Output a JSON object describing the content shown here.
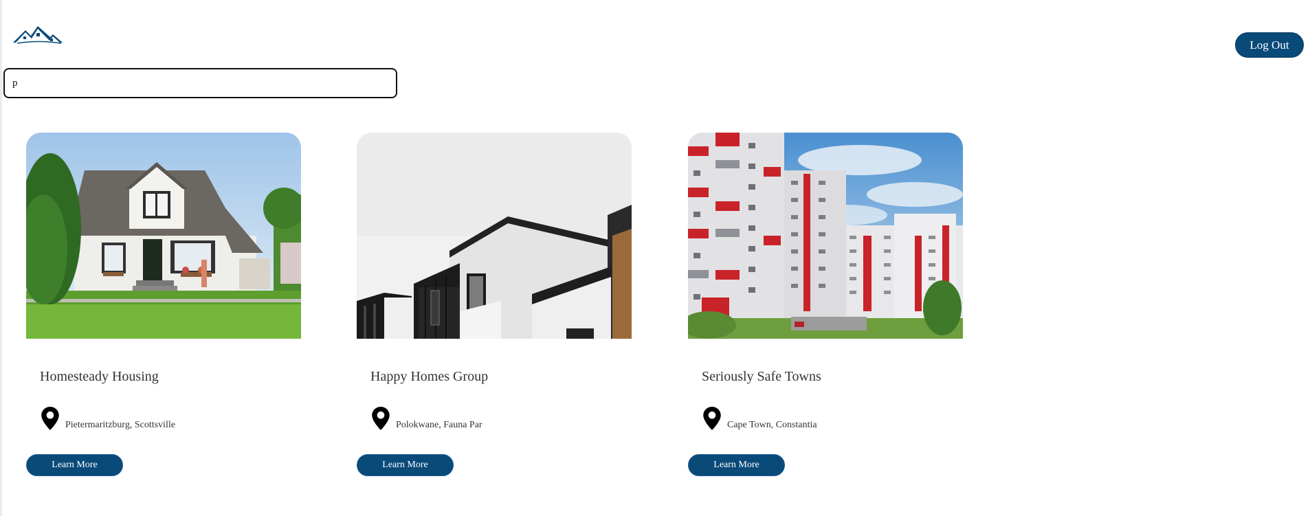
{
  "header": {
    "logo_icon": "house-roof-logo-icon",
    "logout_label": "Log Out",
    "brand_color": "#0a4a79"
  },
  "search": {
    "value": "p",
    "placeholder": ""
  },
  "listings": [
    {
      "title": "Homesteady Housing",
      "location": "Pietermaritzburg, Scottsville",
      "image": "suburban-house-photo",
      "location_icon": "map-pin-icon",
      "button_label": "Learn More"
    },
    {
      "title": "Happy Homes Group",
      "location": "Polokwane, Fauna Par",
      "image": "modern-black-white-house-photo",
      "location_icon": "map-pin-icon",
      "button_label": "Learn More"
    },
    {
      "title": "Seriously Safe Towns",
      "location": "Cape Town, Constantia",
      "image": "apartment-towers-photo",
      "location_icon": "map-pin-icon",
      "button_label": "Learn More"
    }
  ]
}
